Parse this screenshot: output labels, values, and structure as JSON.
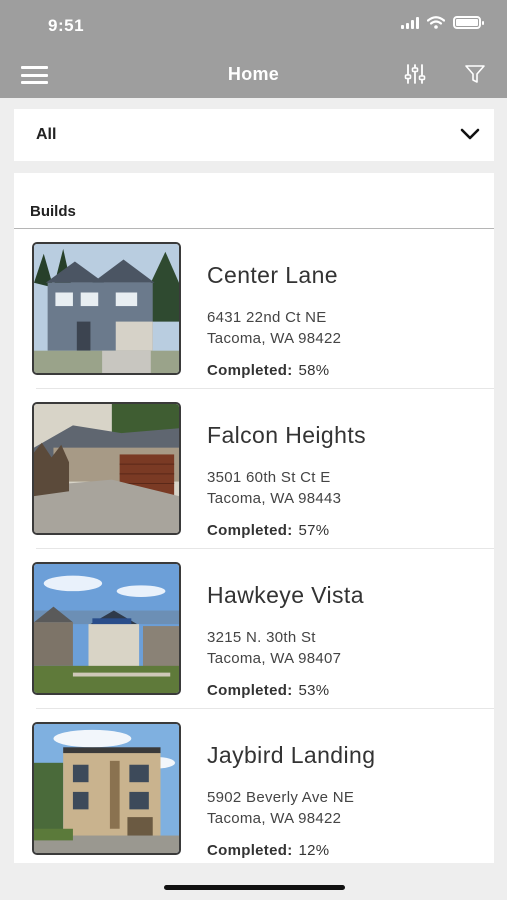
{
  "status": {
    "time": "9:51"
  },
  "nav": {
    "title": "Home",
    "menu_icon": "hamburger-menu-icon",
    "adjust_icon": "sliders-icon",
    "filter_icon": "filter-funnel-icon"
  },
  "filter": {
    "selected": "All",
    "chevron_icon": "chevron-down-icon"
  },
  "builds": {
    "header": "Builds",
    "completed_label": "Completed:",
    "items": [
      {
        "name": "Center Lane",
        "address_line1": "6431 22nd Ct NE",
        "address_line2": "Tacoma, WA 98422",
        "completed": "58%"
      },
      {
        "name": "Falcon Heights",
        "address_line1": "3501 60th St Ct E",
        "address_line2": "Tacoma, WA 98443",
        "completed": "57%"
      },
      {
        "name": "Hawkeye Vista",
        "address_line1": "3215 N. 30th St",
        "address_line2": "Tacoma, WA 98407",
        "completed": "53%"
      },
      {
        "name": "Jaybird Landing",
        "address_line1": "5902 Beverly Ave NE",
        "address_line2": "Tacoma, WA 98422",
        "completed": "12%"
      }
    ]
  },
  "colors": {
    "header_bg": "#9e9e9e",
    "page_bg": "#eeeeee",
    "card_bg": "#ffffff",
    "text": "#333333"
  }
}
